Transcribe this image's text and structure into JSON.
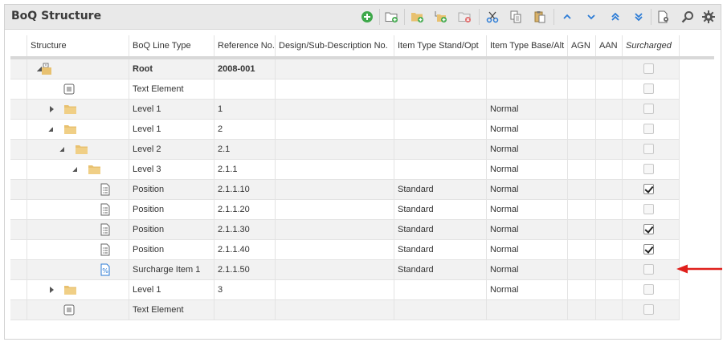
{
  "panel": {
    "title": "BoQ Structure"
  },
  "toolbar": [
    {
      "name": "add-icon"
    },
    {
      "name": "new-folder-icon"
    },
    {
      "name": "add-level-icon"
    },
    {
      "name": "add-sublevel-icon"
    },
    {
      "name": "delete-folder-icon"
    },
    {
      "name": "cut-icon"
    },
    {
      "name": "copy-icon"
    },
    {
      "name": "paste-icon"
    },
    {
      "name": "move-up-icon"
    },
    {
      "name": "move-down-icon"
    },
    {
      "name": "move-top-icon"
    },
    {
      "name": "move-bottom-icon"
    },
    {
      "name": "document-settings-icon"
    },
    {
      "name": "search-icon"
    },
    {
      "name": "gear-icon"
    }
  ],
  "grid": {
    "headers": {
      "structure": "Structure",
      "line_type": "BoQ Line Type",
      "reference": "Reference No.",
      "design": "Design/Sub-Description No.",
      "stand_opt": "Item Type Stand/Opt",
      "base_alt": "Item Type Base/Alt",
      "agn": "AGN",
      "aan": "AAN",
      "surcharged": "Surcharged"
    },
    "rows": [
      {
        "line_type": "Root",
        "reference": "2008-001",
        "stand_opt": "",
        "base_alt": "",
        "surcharged": false,
        "bold": true
      },
      {
        "line_type": "Text Element",
        "reference": "",
        "stand_opt": "",
        "base_alt": "",
        "surcharged": false
      },
      {
        "line_type": "Level 1",
        "reference": "1",
        "stand_opt": "",
        "base_alt": "Normal",
        "surcharged": false
      },
      {
        "line_type": "Level 1",
        "reference": "2",
        "stand_opt": "",
        "base_alt": "Normal",
        "surcharged": false
      },
      {
        "line_type": "Level 2",
        "reference": "2.1",
        "stand_opt": "",
        "base_alt": "Normal",
        "surcharged": false
      },
      {
        "line_type": "Level 3",
        "reference": "2.1.1",
        "stand_opt": "",
        "base_alt": "Normal",
        "surcharged": false
      },
      {
        "line_type": "Position",
        "reference": "2.1.1.10",
        "stand_opt": "Standard",
        "base_alt": "Normal",
        "surcharged": true
      },
      {
        "line_type": "Position",
        "reference": "2.1.1.20",
        "stand_opt": "Standard",
        "base_alt": "Normal",
        "surcharged": false
      },
      {
        "line_type": "Position",
        "reference": "2.1.1.30",
        "stand_opt": "Standard",
        "base_alt": "Normal",
        "surcharged": true
      },
      {
        "line_type": "Position",
        "reference": "2.1.1.40",
        "stand_opt": "Standard",
        "base_alt": "Normal",
        "surcharged": true
      },
      {
        "line_type": "Surcharge Item 1",
        "reference": "2.1.1.50",
        "stand_opt": "Standard",
        "base_alt": "Normal",
        "surcharged": false
      },
      {
        "line_type": "Level 1",
        "reference": "3",
        "stand_opt": "",
        "base_alt": "Normal",
        "surcharged": false
      },
      {
        "line_type": "Text Element",
        "reference": "",
        "stand_opt": "",
        "base_alt": "",
        "surcharged": false
      }
    ]
  },
  "colors": {
    "accent_arrow": "#e0201c",
    "toolbar_blue": "#2b7bd6",
    "folder": "#e8c170",
    "add_green": "#3ea84a"
  }
}
